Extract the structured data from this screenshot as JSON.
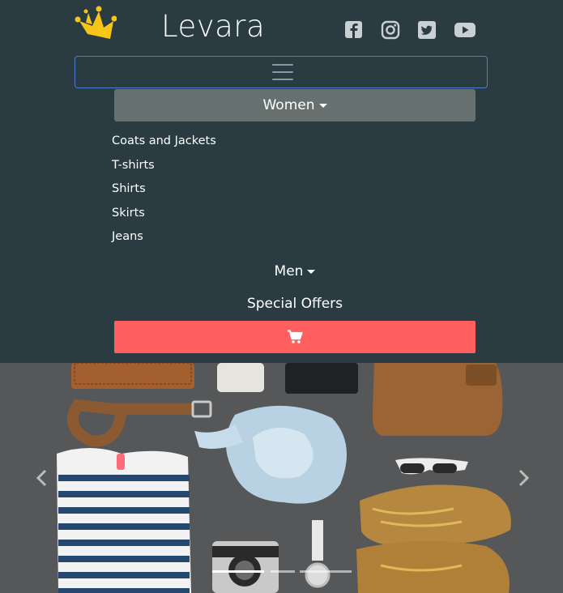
{
  "brand": {
    "name": "Levara",
    "logo_icon": "crown-icon",
    "logo_color": "#f5c518"
  },
  "social": [
    {
      "name": "facebook-icon"
    },
    {
      "name": "instagram-icon"
    },
    {
      "name": "twitter-icon"
    },
    {
      "name": "youtube-icon"
    }
  ],
  "nav": {
    "toggler_icon": "hamburger-icon",
    "women": {
      "label": "Women",
      "items": [
        "Coats and Jackets",
        "T-shirts",
        "Shirts",
        "Skirts",
        "Jeans"
      ]
    },
    "men": {
      "label": "Men"
    },
    "offers": {
      "label": "Special Offers"
    },
    "cart_icon": "cart-icon"
  },
  "carousel": {
    "prev_icon": "chevron-left-icon",
    "next_icon": "chevron-right-icon",
    "indicator_count": 3,
    "active_indicator": 0
  },
  "colors": {
    "header_bg": "#2a3b42",
    "dropdown_bg": "#66716f",
    "cart_button": "#ff5f5f",
    "toggler_border": "#4d7fd1"
  }
}
